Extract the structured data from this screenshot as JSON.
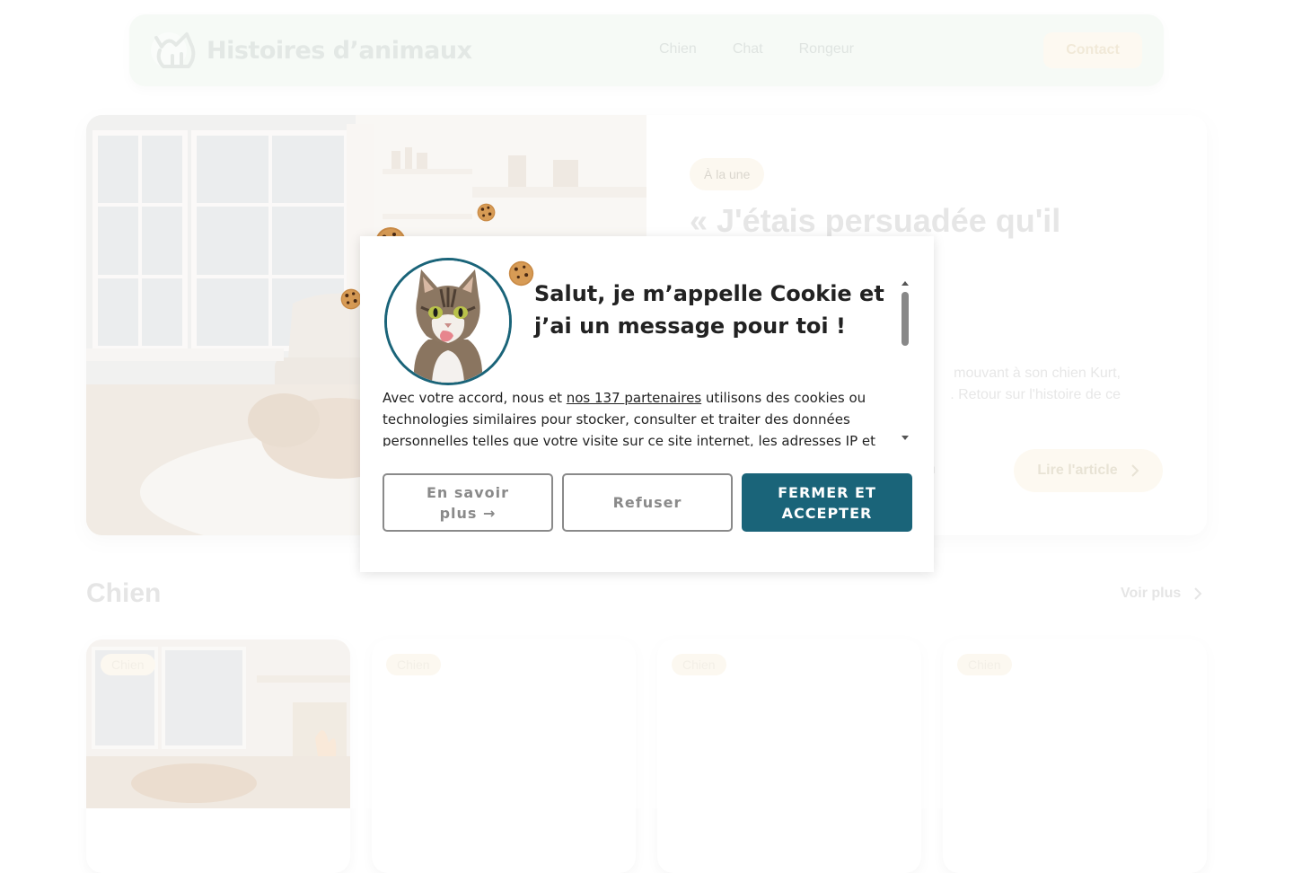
{
  "header": {
    "logo_text": "Histoires d’animaux",
    "nav": [
      "Chien",
      "Chat",
      "Rongeur"
    ],
    "contact_label": "Contact"
  },
  "hero": {
    "badge": "À la une",
    "title": "« J'étais persuadée qu'il\nnes enfants » :\nperd son",
    "description": "mouvant à son chien Kurt,\n. Retour sur l'histoire de ce",
    "meta": "u",
    "read_label": "Lire l'article"
  },
  "section": {
    "title": "Chien",
    "see_more": "Voir plus",
    "cards": [
      {
        "tag": "Chien"
      },
      {
        "tag": "Chien"
      },
      {
        "tag": "Chien"
      },
      {
        "tag": "Chien"
      }
    ]
  },
  "cookie_modal": {
    "title": "Salut, je m’appelle Cookie et j’ai un message pour toi !",
    "text_before_link": "Avec votre accord, nous et ",
    "link_text": "nos 137 partenaires",
    "text_after_link": " utilisons des cookies ou technologies similaires pour stocker, consulter et traiter des données personnelles telles que votre visite sur ce site internet, les adresses IP et",
    "btn_more": "En savoir plus →",
    "btn_refuse": "Refuser",
    "btn_accept": "FERMER ET ACCEPTER"
  },
  "colors": {
    "accent": "#1a6479",
    "header_bg": "#eef6ef",
    "badge_bg": "#faf3e3"
  }
}
